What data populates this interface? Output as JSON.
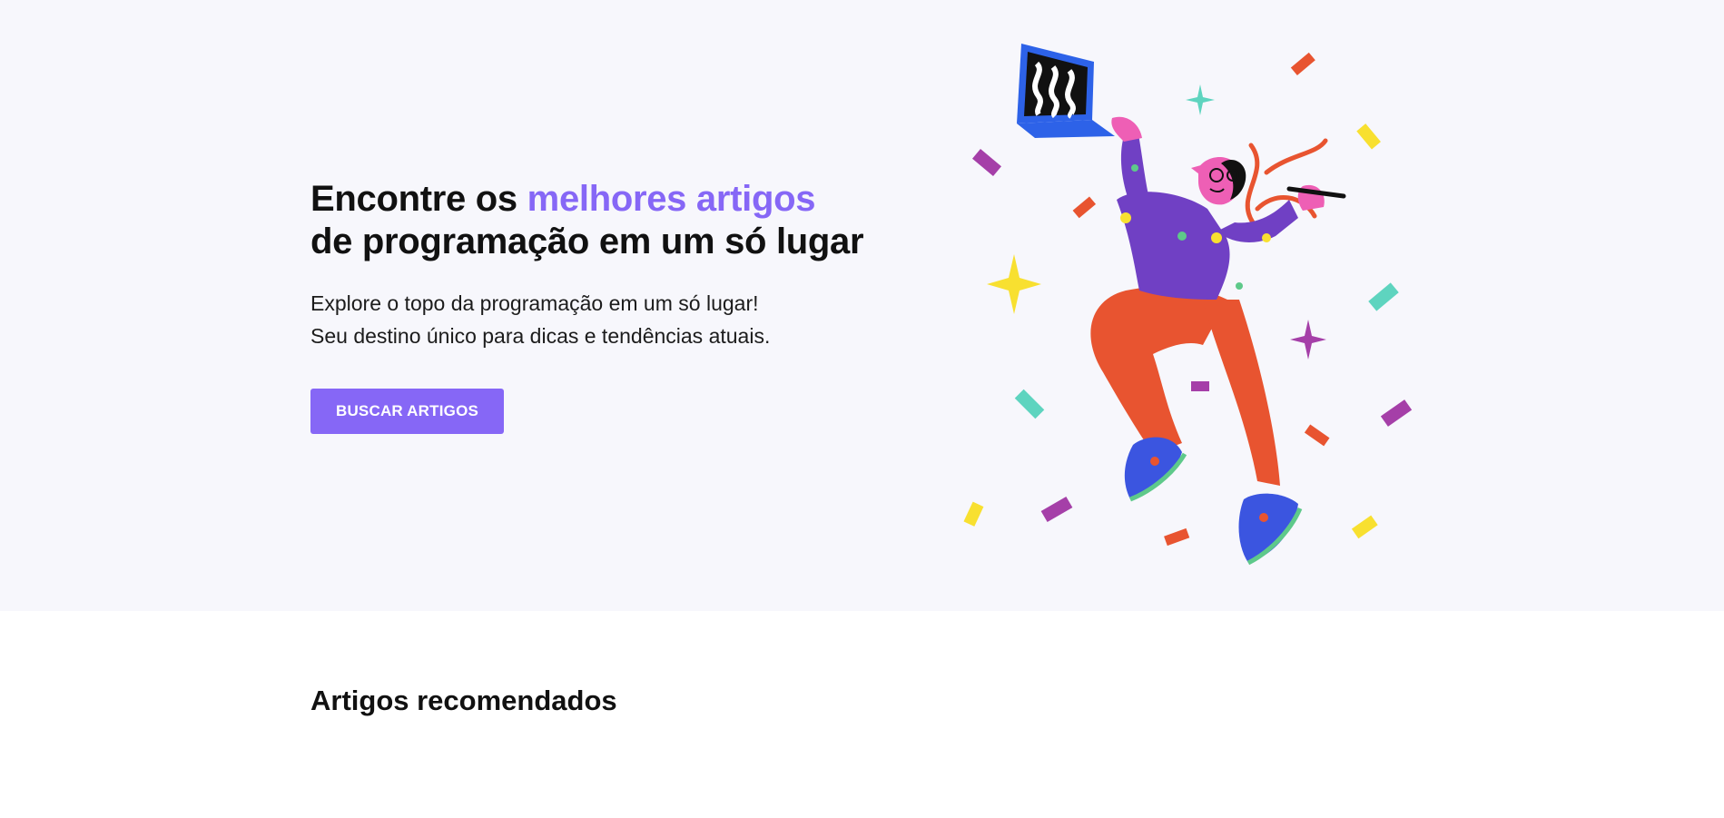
{
  "hero": {
    "title_line1_prefix": "Encontre os ",
    "title_line1_accent": "melhores artigos",
    "title_line2": "de programação em um só lugar",
    "subtitle_line1": "Explore o topo da programação em um só lugar!",
    "subtitle_line2": "Seu destino único para dicas e tendências atuais.",
    "cta_label": "BUSCAR ARTIGOS",
    "illustration_icon": "celebrating-developer-illustration"
  },
  "recommended": {
    "title": "Artigos recomendados"
  },
  "colors": {
    "accent": "#8667f6",
    "hero_background": "#f7f7fc",
    "text": "#111111"
  }
}
